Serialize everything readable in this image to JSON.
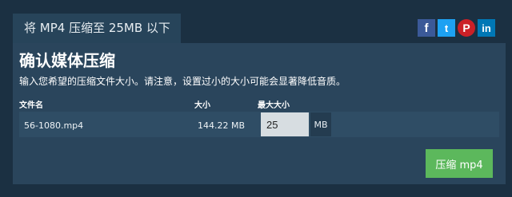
{
  "header": {
    "tab_title": "将 MP4 压缩至 25MB 以下"
  },
  "social": [
    {
      "name": "facebook-icon",
      "glyph": "f",
      "color": "#3b5998"
    },
    {
      "name": "twitter-icon",
      "glyph": "t",
      "color": "#1da1f2"
    },
    {
      "name": "pinterest-icon",
      "glyph": "P",
      "color": "#cb2027"
    },
    {
      "name": "linkedin-icon",
      "glyph": "in",
      "color": "#0077b5"
    }
  ],
  "panel": {
    "title": "确认媒体压缩",
    "description": "输入您希望的压缩文件大小。请注意，设置过小的大小可能会显著降低音质。",
    "columns": {
      "filename": "文件名",
      "size": "大小",
      "max_size": "最大大小"
    },
    "file": {
      "name": "56-1080.mp4",
      "size": "144.22 MB",
      "max_size_value": "25",
      "unit": "MB"
    },
    "compress_button": "压缩 mp4"
  },
  "colors": {
    "background": "#1b3042",
    "panel": "#2a455c",
    "button": "#5cb85c"
  }
}
